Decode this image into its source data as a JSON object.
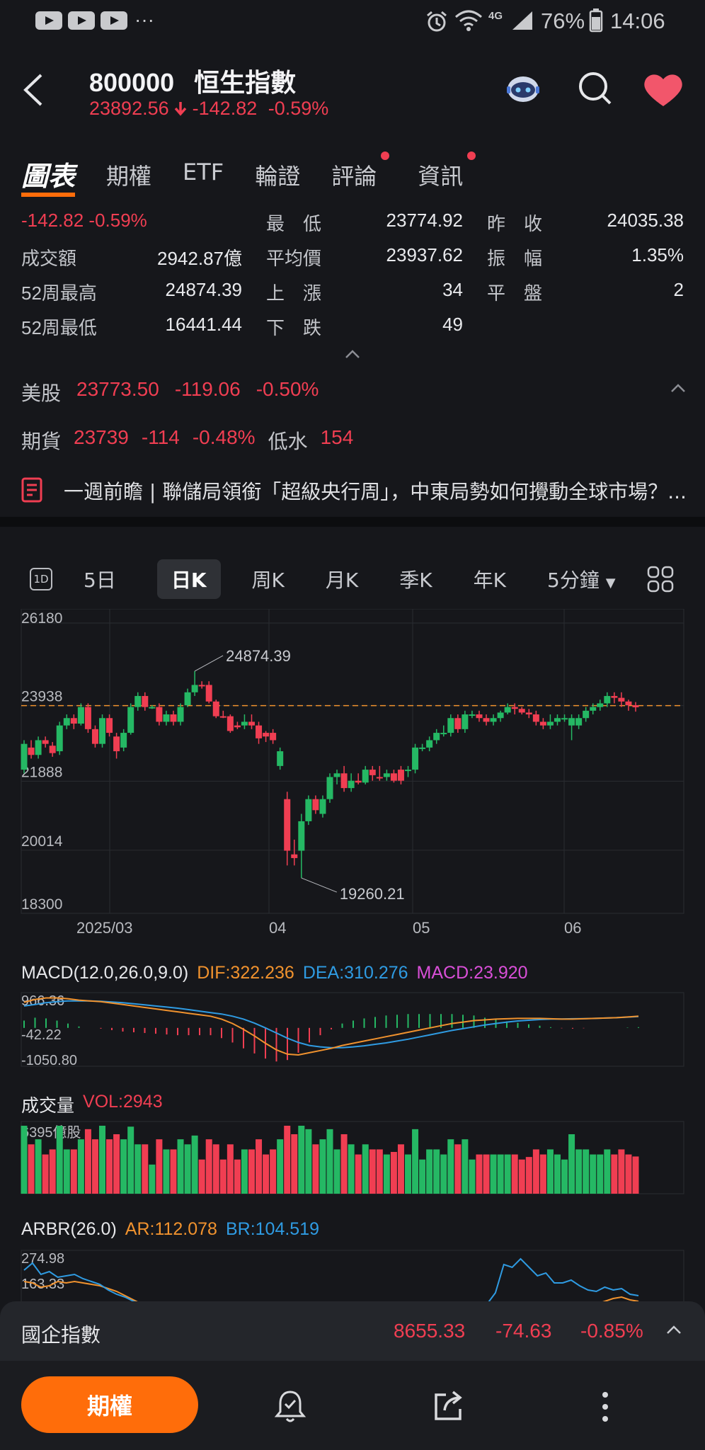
{
  "status": {
    "battery": "76%",
    "time": "14:06",
    "network": "4G",
    "dots": "···"
  },
  "header": {
    "code": "800000",
    "name": "恒生指數",
    "price": "23892.56",
    "change": "-142.82",
    "pct": "-0.59%"
  },
  "tabs": [
    {
      "label": "圖表",
      "active": true
    },
    {
      "label": "期權"
    },
    {
      "label": "ETF"
    },
    {
      "label": "輪證"
    },
    {
      "label": "評論",
      "dot": true
    },
    {
      "label": "資訊",
      "dot": true
    }
  ],
  "stats": {
    "change_text": "-142.82 -0.59%",
    "turnover_label": "成交額",
    "turnover": "2942.87億",
    "high52_label": "52周最高",
    "high52": "24874.39",
    "low52_label": "52周最低",
    "low52": "16441.44",
    "low_label": "最　低",
    "low": "23774.92",
    "avg_label": "平均價",
    "avg": "23937.62",
    "up_label": "上　漲",
    "up": "34",
    "down_label": "下　跌",
    "down": "49",
    "prev_label": "昨　收",
    "prev": "24035.38",
    "amp_label": "振　幅",
    "amp": "1.35%",
    "flat_label": "平　盤",
    "flat": "2"
  },
  "us": {
    "label": "美股",
    "price": "23773.50",
    "change": "-119.06",
    "pct": "-0.50%"
  },
  "fut": {
    "label": "期貨",
    "price": "23739",
    "change": "-114",
    "pct": "-0.48%",
    "disc_label": "低水",
    "disc": "154"
  },
  "news": {
    "text": "一週前瞻 | 聯儲局領銜「超級央行周」，中東局勢如何攪動全球市場？..."
  },
  "periods": [
    "5日",
    "日K",
    "周K",
    "月K",
    "季K",
    "年K",
    "5分鐘"
  ],
  "period_1d_label": "1D",
  "chart_data": {
    "type": "candlestick",
    "y_ticks": [
      "26180",
      "23938",
      "21888",
      "20014",
      "18300"
    ],
    "x_ticks": [
      "2025/03",
      "04",
      "05",
      "06"
    ],
    "ylim": [
      18300,
      26180
    ],
    "ref_line": 23938,
    "annotations": [
      {
        "label": "24874.39",
        "value": 24874.39
      },
      {
        "label": "19260.21",
        "value": 19260.21
      }
    ],
    "candles": [
      [
        22200,
        22900,
        22100,
        23000,
        1
      ],
      [
        22800,
        22600,
        22500,
        23000,
        0
      ],
      [
        22600,
        23000,
        22500,
        23100,
        1
      ],
      [
        23000,
        22900,
        22800,
        23100,
        0
      ],
      [
        22850,
        22650,
        22550,
        22950,
        0
      ],
      [
        22700,
        23400,
        22600,
        23500,
        1
      ],
      [
        23400,
        23600,
        23300,
        23700,
        1
      ],
      [
        23600,
        23450,
        23300,
        23700,
        0
      ],
      [
        23450,
        23900,
        23400,
        24000,
        1
      ],
      [
        23900,
        23300,
        23200,
        24000,
        0
      ],
      [
        23300,
        22900,
        22800,
        23400,
        0
      ],
      [
        22900,
        23600,
        22800,
        23700,
        1
      ],
      [
        23600,
        23200,
        23100,
        23700,
        0
      ],
      [
        23100,
        22700,
        22500,
        23200,
        0
      ],
      [
        22800,
        23200,
        22700,
        23300,
        1
      ],
      [
        23200,
        23900,
        23150,
        24000,
        1
      ],
      [
        23900,
        24200,
        23800,
        24300,
        1
      ],
      [
        24200,
        23900,
        23800,
        24300,
        0
      ],
      [
        23900,
        23900,
        23850,
        23950,
        1
      ],
      [
        23900,
        23500,
        23400,
        24000,
        0
      ],
      [
        23500,
        23700,
        23400,
        23800,
        1
      ],
      [
        23700,
        23500,
        23400,
        23800,
        0
      ],
      [
        23500,
        23900,
        23400,
        24000,
        1
      ],
      [
        23950,
        24300,
        23900,
        24400,
        1
      ],
      [
        24300,
        24500,
        24200,
        24874,
        1
      ],
      [
        24500,
        24500,
        24400,
        24600,
        0
      ],
      [
        24500,
        24050,
        24000,
        24600,
        0
      ],
      [
        24050,
        23650,
        23600,
        24100,
        0
      ],
      [
        23650,
        23650,
        23600,
        23800,
        0
      ],
      [
        23650,
        23250,
        23200,
        23700,
        0
      ],
      [
        23400,
        23350,
        23300,
        23500,
        0
      ],
      [
        23400,
        23500,
        23300,
        23700,
        1
      ],
      [
        23500,
        23400,
        23300,
        23700,
        0
      ],
      [
        23400,
        23050,
        22900,
        23500,
        0
      ],
      [
        23100,
        23200,
        22950,
        23250,
        0
      ],
      [
        23200,
        23000,
        22900,
        23300,
        0
      ],
      [
        22700,
        22300,
        22200,
        22800,
        1
      ],
      [
        21400,
        20000,
        19600,
        21600,
        0
      ],
      [
        19800,
        19900,
        19600,
        20300,
        0
      ],
      [
        20000,
        20800,
        19260,
        21000,
        1
      ],
      [
        20800,
        21400,
        20700,
        21500,
        1
      ],
      [
        21400,
        21100,
        21000,
        21500,
        0
      ],
      [
        21000,
        21400,
        20900,
        21500,
        1
      ],
      [
        21400,
        22000,
        21300,
        22100,
        1
      ],
      [
        22000,
        22100,
        21800,
        22200,
        1
      ],
      [
        22100,
        21700,
        21600,
        22300,
        0
      ],
      [
        21700,
        21900,
        21600,
        22100,
        1
      ],
      [
        21900,
        21850,
        21800,
        22100,
        0
      ],
      [
        21850,
        22200,
        21800,
        22300,
        1
      ],
      [
        22200,
        22050,
        21900,
        22300,
        0
      ],
      [
        22000,
        22000,
        21900,
        22300,
        0
      ],
      [
        22000,
        22100,
        21900,
        22200,
        1
      ],
      [
        22100,
        21900,
        21850,
        22200,
        0
      ],
      [
        21900,
        22200,
        21800,
        22300,
        0
      ],
      [
        22200,
        22200,
        22000,
        22300,
        1
      ],
      [
        22200,
        22800,
        22100,
        22900,
        1
      ],
      [
        22800,
        22800,
        22700,
        22900,
        1
      ],
      [
        22800,
        23000,
        22700,
        23100,
        1
      ],
      [
        23000,
        23200,
        22900,
        23300,
        1
      ],
      [
        23200,
        23200,
        23100,
        23400,
        1
      ],
      [
        23200,
        23600,
        23100,
        23700,
        1
      ],
      [
        23600,
        23300,
        23200,
        23700,
        0
      ],
      [
        23300,
        23700,
        23200,
        23800,
        1
      ],
      [
        23700,
        23700,
        23600,
        23800,
        1
      ],
      [
        23700,
        23600,
        23500,
        23800,
        0
      ],
      [
        23600,
        23500,
        23400,
        23700,
        0
      ],
      [
        23500,
        23600,
        23400,
        23700,
        1
      ],
      [
        23600,
        23750,
        23500,
        23800,
        1
      ],
      [
        23750,
        23900,
        23700,
        24000,
        1
      ],
      [
        23900,
        23850,
        23700,
        24000,
        0
      ],
      [
        23850,
        23750,
        23700,
        23900,
        0
      ],
      [
        23750,
        23700,
        23600,
        23850,
        0
      ],
      [
        23700,
        23500,
        23400,
        23800,
        0
      ],
      [
        23500,
        23400,
        23300,
        23600,
        0
      ],
      [
        23400,
        23500,
        23300,
        23700,
        1
      ],
      [
        23500,
        23600,
        23400,
        23700,
        1
      ],
      [
        23600,
        23600,
        23500,
        23700,
        1
      ],
      [
        23600,
        23400,
        23000,
        23700,
        1
      ],
      [
        23400,
        23600,
        23300,
        23700,
        1
      ],
      [
        23600,
        23800,
        23500,
        23900,
        1
      ],
      [
        23800,
        23900,
        23700,
        24000,
        1
      ],
      [
        23900,
        24000,
        23800,
        24100,
        1
      ],
      [
        24000,
        24200,
        23900,
        24300,
        1
      ],
      [
        24200,
        24150,
        24000,
        24300,
        0
      ],
      [
        24150,
        24050,
        23900,
        24300,
        0
      ],
      [
        24050,
        23950,
        23800,
        24100,
        0
      ],
      [
        23950,
        23893,
        23775,
        24035,
        0
      ]
    ]
  },
  "macd": {
    "title": "MACD(12.0,26.0,9.0)",
    "dif": "DIF:322.236",
    "dea": "DEA:310.276",
    "macd": "MACD:23.920",
    "y_ticks": [
      "966.36",
      "-42.22",
      "-1050.80"
    ],
    "dif_values": [
      700,
      780,
      820,
      820,
      800,
      760,
      740,
      720,
      680,
      640,
      600,
      560,
      520,
      480,
      440,
      400,
      360,
      320,
      240,
      120,
      -40,
      -220,
      -420,
      -600,
      -720,
      -740,
      -680,
      -620,
      -560,
      -480,
      -420,
      -360,
      -300,
      -240,
      -180,
      -120,
      -60,
      0,
      60,
      120,
      160,
      200,
      220,
      240,
      250,
      260,
      260,
      260,
      250,
      240,
      240,
      250,
      260,
      270,
      280,
      300,
      320
    ],
    "dea_values": [
      600,
      640,
      690,
      720,
      740,
      740,
      740,
      730,
      710,
      690,
      660,
      630,
      600,
      570,
      540,
      500,
      460,
      420,
      380,
      320,
      240,
      130,
      0,
      -140,
      -280,
      -400,
      -480,
      -520,
      -540,
      -540,
      -520,
      -490,
      -450,
      -410,
      -360,
      -310,
      -250,
      -190,
      -130,
      -70,
      -20,
      30,
      80,
      120,
      160,
      190,
      210,
      230,
      240,
      245,
      250,
      255,
      260,
      270,
      280,
      295,
      310
    ]
  },
  "vol": {
    "title": "成交量",
    "vol": "VOL:2943",
    "max_label": "6395億股"
  },
  "arbr": {
    "title": "ARBR(26.0)",
    "ar": "AR:112.078",
    "br": "BR:104.519",
    "y_ticks": [
      "274.98",
      "163.33"
    ]
  },
  "hscei": {
    "label": "國企指數",
    "price": "8655.33",
    "change": "-74.63",
    "pct": "-0.85%"
  },
  "bottom": {
    "main": "期權"
  },
  "colors": {
    "up": "#f03e52",
    "down": "#25b864",
    "accent": "#ff6d0a",
    "dif": "#f0922e",
    "dea": "#2f9be2",
    "macd": "#d94fd8"
  }
}
